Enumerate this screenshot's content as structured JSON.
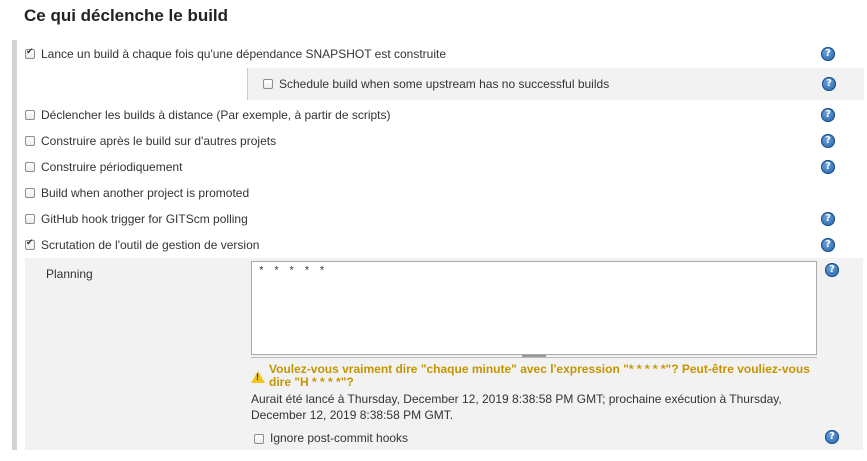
{
  "section_title": "Ce qui déclenche le build",
  "triggers": [
    {
      "label": "Lance un build à chaque fois qu'une dépendance SNAPSHOT est construite",
      "checked": true
    },
    {
      "label": "Schedule build when some upstream has no successful builds",
      "checked": false
    },
    {
      "label": "Déclencher les builds à distance (Par exemple, à partir de scripts)",
      "checked": false
    },
    {
      "label": "Construire après le build sur d'autres projets",
      "checked": false
    },
    {
      "label": "Construire périodiquement",
      "checked": false
    },
    {
      "label": "Build when another project is promoted",
      "checked": false
    },
    {
      "label": "GitHub hook trigger for GITScm polling",
      "checked": false
    },
    {
      "label": "Scrutation de l'outil de gestion de version",
      "checked": true
    }
  ],
  "planning": {
    "label": "Planning",
    "value": "* * * * *",
    "warning_line1": "Voulez-vous vraiment dire \"chaque minute\" avec l'expression  \"* * * * *\"? Peut-être vouliez-vous",
    "warning_line2": "dire \"H * * * *\"?",
    "info_line1": "Aurait été lancé à Thursday, December 12, 2019 8:38:58 PM GMT; prochaine exécution à Thursday,",
    "info_line2": "December 12, 2019 8:38:58 PM GMT."
  },
  "ignore_post_commit": {
    "label": "Ignore post-commit hooks",
    "checked": false
  },
  "help_glyph": "?",
  "colors": {
    "warning": "#c59500",
    "help": "#1f5fa8",
    "panel_grey": "#f2f2f2"
  }
}
